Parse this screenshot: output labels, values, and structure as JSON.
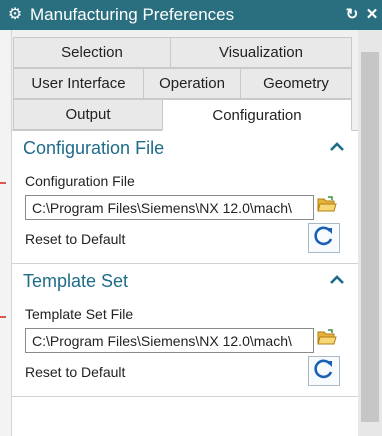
{
  "window": {
    "title": "Manufacturing Preferences",
    "icon": "gear-icon",
    "accent_color": "#2a6f80"
  },
  "tabs": {
    "row1": [
      "Selection",
      "Visualization"
    ],
    "row2": [
      "User Interface",
      "Operation",
      "Geometry"
    ],
    "row3": [
      "Output",
      "Configuration"
    ],
    "active": "Configuration"
  },
  "sections": {
    "config": {
      "title": "Configuration File",
      "field_label": "Configuration File",
      "path_value": "C:\\Program Files\\Siemens\\NX 12.0\\mach\\",
      "reset_label": "Reset to Default"
    },
    "template": {
      "title": "Template Set",
      "field_label": "Template Set File",
      "path_value": "C:\\Program Files\\Siemens\\NX 12.0\\mach\\",
      "reset_label": "Reset to Default"
    }
  },
  "colors": {
    "section_title": "#1f6b8a",
    "folder_icon": "#f2c54b"
  }
}
